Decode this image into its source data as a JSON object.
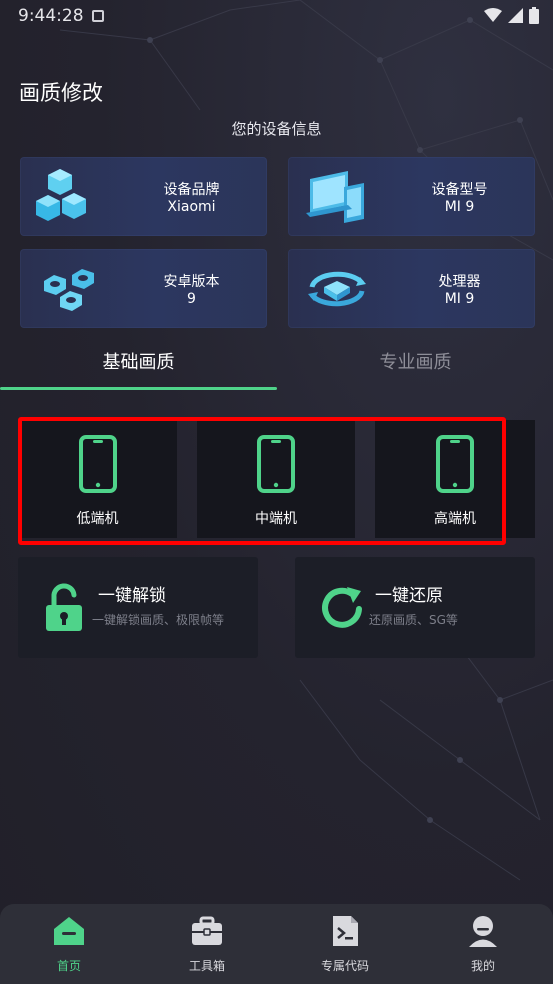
{
  "status_bar": {
    "time": "9:44:28"
  },
  "header": {
    "title": "画质修改"
  },
  "device_info": {
    "title": "您的设备信息",
    "cards": [
      {
        "label": "设备品牌",
        "value": "Xiaomi",
        "icon": "cubes-icon"
      },
      {
        "label": "设备型号",
        "value": "MI 9",
        "icon": "devices-icon"
      },
      {
        "label": "安卓版本",
        "value": "9",
        "icon": "nuts-icon"
      },
      {
        "label": "处理器",
        "value": "MI 9",
        "icon": "processor-icon"
      }
    ]
  },
  "tabs": [
    {
      "label": "基础画质",
      "active": true
    },
    {
      "label": "专业画质",
      "active": false
    }
  ],
  "device_levels": [
    {
      "label": "低端机",
      "icon": "phone-icon"
    },
    {
      "label": "中端机",
      "icon": "phone-icon"
    },
    {
      "label": "高端机",
      "icon": "phone-icon"
    }
  ],
  "actions": [
    {
      "title": "一键解锁",
      "subtitle": "一键解锁画质、极限帧等",
      "icon": "unlock-icon"
    },
    {
      "title": "一键还原",
      "subtitle": "还原画质、SG等",
      "icon": "refresh-icon"
    }
  ],
  "bottom_nav": [
    {
      "label": "首页",
      "icon": "home-icon",
      "active": true
    },
    {
      "label": "工具箱",
      "icon": "toolbox-icon",
      "active": false
    },
    {
      "label": "专属代码",
      "icon": "code-file-icon",
      "active": false
    },
    {
      "label": "我的",
      "icon": "user-icon",
      "active": false
    }
  ],
  "colors": {
    "accent": "#4fd38a",
    "highlight": "#ff0000",
    "background": "#24232e"
  }
}
